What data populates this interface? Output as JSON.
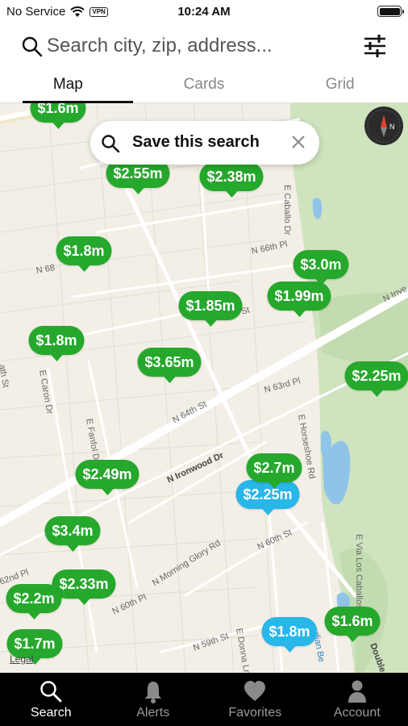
{
  "status_bar": {
    "carrier": "No Service",
    "vpn": "VPN",
    "time": "10:24 AM"
  },
  "search": {
    "placeholder": "Search city, zip, address..."
  },
  "tabs": [
    {
      "label": "Map",
      "active": true
    },
    {
      "label": "Cards",
      "active": false
    },
    {
      "label": "Grid",
      "active": false
    }
  ],
  "map": {
    "save_search": {
      "label": "Save this search"
    },
    "legal": "Legal",
    "street_labels": [
      "N 66th Pl",
      "E Caballo Dr",
      "N 68",
      "N 65th St",
      "E Caron Dr",
      "E Fanfol Dr",
      "N 64th St",
      "N 63rd Pl",
      "E Horseshoe Rd",
      "N Inve",
      "N Ironwood Dr",
      "N Morning Glory Rd",
      "N 60th St",
      "N 60th Pl",
      "N 59th St",
      "E Donna Ln",
      "E Via Los Caballos",
      "62nd Pl",
      "ath St",
      "Double",
      "dian Be"
    ],
    "pins": [
      {
        "price": "$1.6m",
        "color": "green"
      },
      {
        "price": "$2.55m",
        "color": "green"
      },
      {
        "price": "$2.38m",
        "color": "green"
      },
      {
        "price": "$1.8m",
        "color": "green"
      },
      {
        "price": "$1.99m",
        "color": "green"
      },
      {
        "price": "$3.0m",
        "color": "green"
      },
      {
        "price": "$1.85m",
        "color": "green"
      },
      {
        "price": "$1.8m",
        "color": "green"
      },
      {
        "price": "$3.65m",
        "color": "green"
      },
      {
        "price": "$2.25m",
        "color": "green"
      },
      {
        "price": "$2.49m",
        "color": "green"
      },
      {
        "price": "$2.7m",
        "color": "green"
      },
      {
        "price": "$2.25m",
        "color": "blue"
      },
      {
        "price": "$3.4m",
        "color": "green"
      },
      {
        "price": "$2.33m",
        "color": "green"
      },
      {
        "price": "$2.2m",
        "color": "green"
      },
      {
        "price": "$1.7m",
        "color": "green"
      },
      {
        "price": "$1.8m",
        "color": "blue"
      },
      {
        "price": "$1.6m",
        "color": "green"
      }
    ]
  },
  "bottom_nav": [
    {
      "label": "Search",
      "icon": "search-icon",
      "active": true
    },
    {
      "label": "Alerts",
      "icon": "bell-icon",
      "active": false
    },
    {
      "label": "Favorites",
      "icon": "heart-icon",
      "active": false
    },
    {
      "label": "Account",
      "icon": "person-icon",
      "active": false
    }
  ],
  "colors": {
    "pin_green": "#25a82c",
    "pin_blue": "#29b6e8",
    "park_green": "#cfe3bf",
    "water": "#8fc4e8"
  }
}
